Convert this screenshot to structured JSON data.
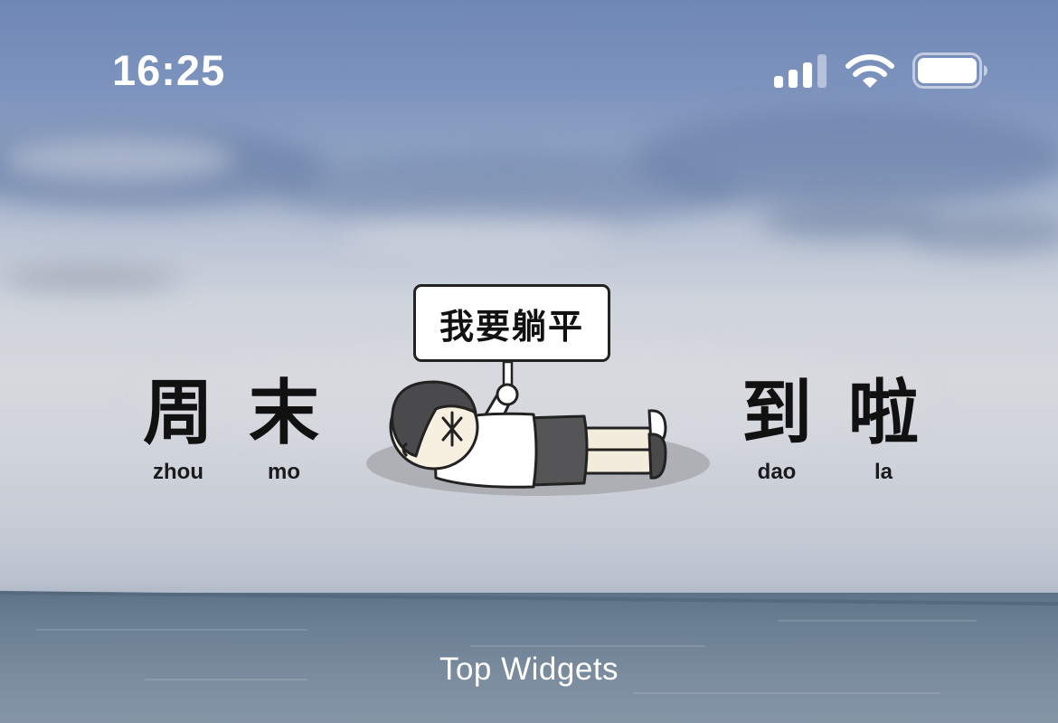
{
  "status_bar": {
    "time": "16:25",
    "signal_icon": "cellular-signal-icon",
    "wifi_icon": "wifi-icon",
    "battery_icon": "battery-icon"
  },
  "widget": {
    "sign_text": "我要躺平",
    "words": [
      {
        "hanzi": "周",
        "pinyin": "zhou"
      },
      {
        "hanzi": "末",
        "pinyin": "mo"
      },
      {
        "hanzi": "到",
        "pinyin": "dao"
      },
      {
        "hanzi": "啦",
        "pinyin": "la"
      }
    ],
    "illustration_icon": "lying-person-illustration"
  },
  "widget_label": "Top Widgets",
  "colors": {
    "status_text": "#ffffff",
    "widget_text": "#111111",
    "sky": "#7c93bd",
    "sea": "#6b7f93"
  }
}
